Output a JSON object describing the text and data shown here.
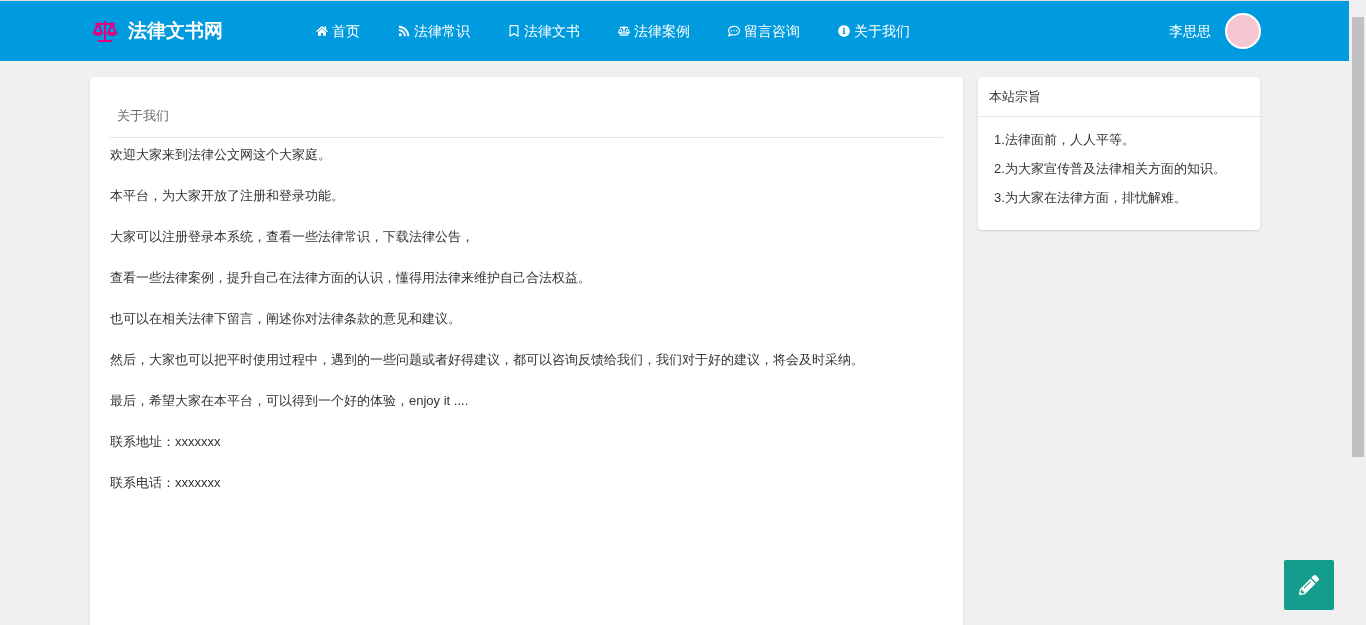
{
  "header": {
    "logo_text": "法律文书网",
    "nav": [
      {
        "label": "首页"
      },
      {
        "label": "法律常识"
      },
      {
        "label": "法律文书"
      },
      {
        "label": "法律案例"
      },
      {
        "label": "留言咨询"
      },
      {
        "label": "关于我们"
      }
    ],
    "user_name": "李思思"
  },
  "main": {
    "title": "关于我们",
    "paragraphs": [
      "欢迎大家来到法律公文网这个大家庭。",
      "本平台，为大家开放了注册和登录功能。",
      "大家可以注册登录本系统，查看一些法律常识，下载法律公告，",
      "查看一些法律案例，提升自己在法律方面的认识，懂得用法律来维护自己合法权益。",
      "也可以在相关法律下留言，阐述你对法律条款的意见和建议。",
      "然后，大家也可以把平时使用过程中，遇到的一些问题或者好得建议，都可以咨询反馈给我们，我们对于好的建议，将会及时采纳。",
      "最后，希望大家在本平台，可以得到一个好的体验，enjoy it ....",
      "联系地址：xxxxxxx",
      "联系电话：xxxxxxx"
    ]
  },
  "sidebar": {
    "title": "本站宗旨",
    "items": [
      "1.法律面前，人人平等。",
      "2.为大家宣传普及法律相关方面的知识。",
      "3.为大家在法律方面，排忧解难。"
    ]
  }
}
